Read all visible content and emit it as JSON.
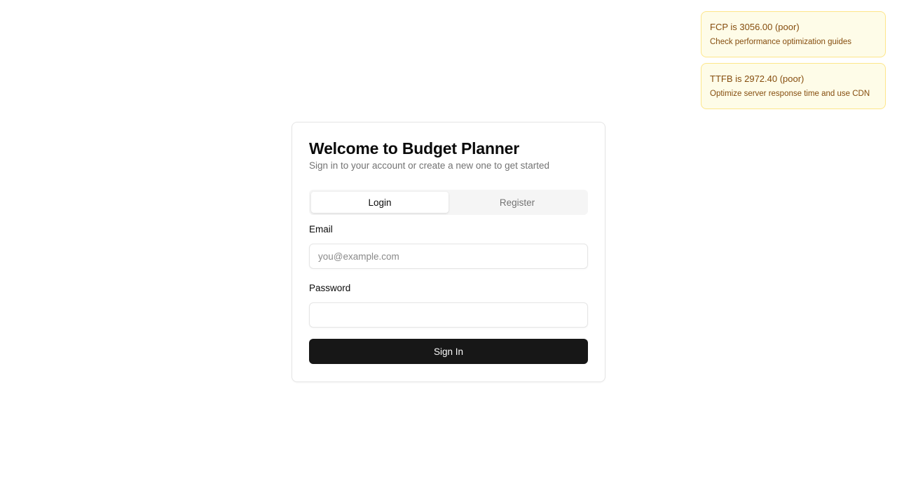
{
  "toasts": [
    {
      "title": "FCP is 3056.00 (poor)",
      "description": "Check performance optimization guides"
    },
    {
      "title": "TTFB is 2972.40 (poor)",
      "description": "Optimize server response time and use CDN"
    }
  ],
  "auth": {
    "title": "Welcome to Budget Planner",
    "subtitle": "Sign in to your account or create a new one to get started",
    "tabs": [
      {
        "label": "Login",
        "active": true
      },
      {
        "label": "Register",
        "active": false
      }
    ],
    "email": {
      "label": "Email",
      "placeholder": "you@example.com",
      "value": ""
    },
    "password": {
      "label": "Password",
      "placeholder": "",
      "value": ""
    },
    "submit_label": "Sign In"
  },
  "colors": {
    "toast_bg": "#fefce8",
    "toast_border": "#fde68a",
    "toast_text": "#854d0e",
    "primary_button": "#171717",
    "muted_text": "#737373"
  }
}
